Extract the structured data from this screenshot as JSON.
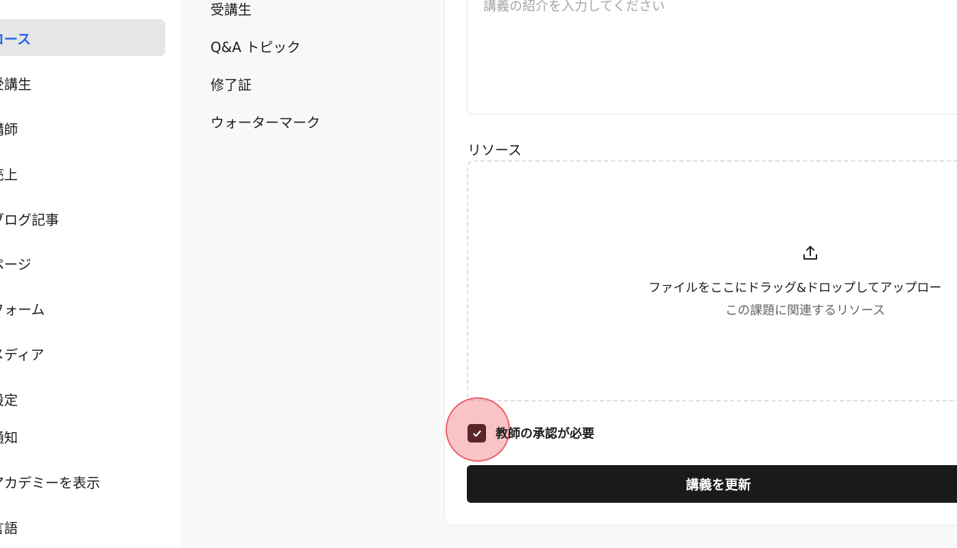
{
  "sidebar": {
    "items": [
      {
        "label": "コース",
        "active": true
      },
      {
        "label": "受講生"
      },
      {
        "label": "講師"
      },
      {
        "label": "売上"
      },
      {
        "label": "ブログ記事"
      },
      {
        "label": "ページ"
      },
      {
        "label": "フォーム"
      },
      {
        "label": "メディア"
      },
      {
        "label": "設定"
      },
      {
        "label": "通知"
      },
      {
        "label": "アカデミーを表示"
      },
      {
        "label": "言語"
      }
    ]
  },
  "course_nav": {
    "items": [
      {
        "label": "受講生"
      },
      {
        "label": "Q&A トピック"
      },
      {
        "label": "修了証"
      },
      {
        "label": "ウォーターマーク"
      }
    ]
  },
  "form": {
    "intro_placeholder": "講義の紹介を入力してください",
    "resources_label": "リソース",
    "dropzone_text": "ファイルをここにドラッグ&ドロップしてアップロー",
    "dropzone_subtext": "この課題に関連するリソース",
    "teacher_approval_label": "教師の承認が必要",
    "teacher_approval_checked": true,
    "submit_label": "講義を更新"
  },
  "colors": {
    "active_nav_text": "#2563eb",
    "checkbox_fill": "#5d252a",
    "submit_bg": "#1a1a1a"
  }
}
